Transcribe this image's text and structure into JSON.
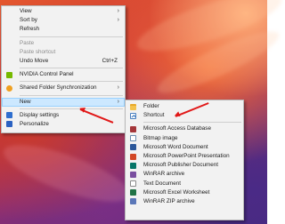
{
  "context_menu": {
    "items": [
      {
        "label": "View",
        "submenu": true
      },
      {
        "label": "Sort by",
        "submenu": true
      },
      {
        "label": "Refresh"
      },
      {
        "label": "Paste",
        "disabled": true
      },
      {
        "label": "Paste shortcut",
        "disabled": true
      },
      {
        "label": "Undo Move",
        "shortcut": "Ctrl+Z"
      },
      {
        "label": "NVIDIA Control Panel",
        "icon": "nvidia-icon"
      },
      {
        "label": "Shared Folder Synchronization",
        "icon": "sync-icon",
        "submenu": true
      },
      {
        "label": "New",
        "submenu": true,
        "highlighted": true
      },
      {
        "label": "Display settings",
        "icon": "display-icon"
      },
      {
        "label": "Personalize",
        "icon": "personalize-icon"
      }
    ],
    "submenu_arrow": "›"
  },
  "new_submenu": {
    "items": [
      {
        "label": "Folder",
        "icon": "folder-icon"
      },
      {
        "label": "Shortcut",
        "icon": "shortcut-icon"
      },
      {
        "label": "Microsoft Access Database",
        "icon": "access-icon"
      },
      {
        "label": "Bitmap image",
        "icon": "bitmap-icon"
      },
      {
        "label": "Microsoft Word Document",
        "icon": "word-icon"
      },
      {
        "label": "Microsoft PowerPoint Presentation",
        "icon": "powerpoint-icon"
      },
      {
        "label": "Microsoft Publisher Document",
        "icon": "publisher-icon"
      },
      {
        "label": "WinRAR archive",
        "icon": "winrar-icon"
      },
      {
        "label": "Text Document",
        "icon": "text-icon"
      },
      {
        "label": "Microsoft Excel Worksheet",
        "icon": "excel-icon"
      },
      {
        "label": "WinRAR ZIP archive",
        "icon": "zip-icon"
      }
    ]
  },
  "colors": {
    "menu_bg": "#f2f2f2",
    "highlight": "#cce8ff",
    "annotation_arrow": "#e11818"
  }
}
